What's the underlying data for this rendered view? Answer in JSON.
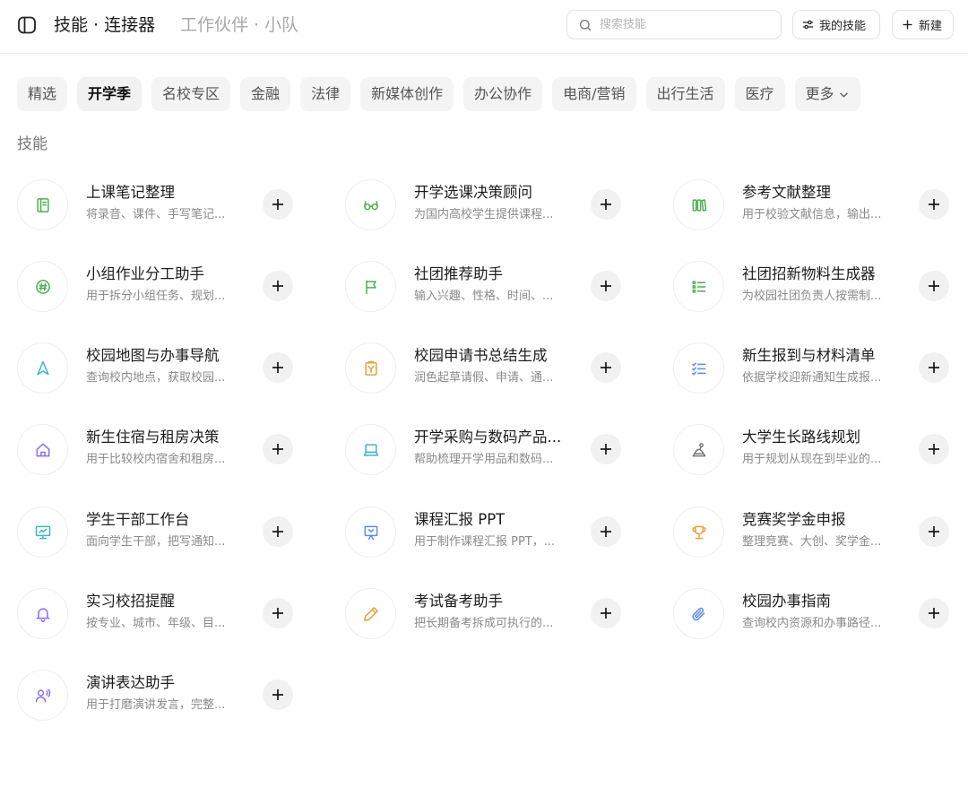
{
  "header": {
    "title_active": "技能 · 连接器",
    "title_inactive": "工作伙伴 · 小队",
    "search_placeholder": "搜索技能",
    "my_skills_label": "我的技能",
    "new_label": "新建"
  },
  "tabs": [
    {
      "label": "精选"
    },
    {
      "label": "开学季",
      "active": true
    },
    {
      "label": "名校专区"
    },
    {
      "label": "金融"
    },
    {
      "label": "法律"
    },
    {
      "label": "新媒体创作"
    },
    {
      "label": "办公协作"
    },
    {
      "label": "电商/营销"
    },
    {
      "label": "出行生活"
    },
    {
      "label": "医疗"
    },
    {
      "label": "更多",
      "dropdown": true
    }
  ],
  "section_label": "技能",
  "skills": [
    {
      "title": "上课笔记整理",
      "desc": "将录音、课件、手写笔记...",
      "icon": "notebook-icon",
      "color": "#4caf50"
    },
    {
      "title": "开学选课决策顾问",
      "desc": "为国内高校学生提供课程...",
      "icon": "glasses-icon",
      "color": "#4caf50"
    },
    {
      "title": "参考文献整理",
      "desc": "用于校验文献信息，输出...",
      "icon": "books-icon",
      "color": "#4caf50"
    },
    {
      "title": "小组作业分工助手",
      "desc": "用于拆分小组任务、规划...",
      "icon": "hashtag-icon",
      "color": "#4caf50"
    },
    {
      "title": "社团推荐助手",
      "desc": "输入兴趣、性格、时间、...",
      "icon": "flag-icon",
      "color": "#4caf50"
    },
    {
      "title": "社团招新物料生成器",
      "desc": "为校园社团负责人按需制...",
      "icon": "list-icon",
      "color": "#4caf50"
    },
    {
      "title": "校园地图与办事导航",
      "desc": "查询校内地点，获取校园...",
      "icon": "navigation-icon",
      "color": "#3fb6c4"
    },
    {
      "title": "校园申请书总结生成",
      "desc": "润色起草请假、申请、通...",
      "icon": "clipboard-icon",
      "color": "#e6a23c"
    },
    {
      "title": "新生报到与材料清单",
      "desc": "依据学校迎新通知生成报...",
      "icon": "checklist-icon",
      "color": "#5b8def"
    },
    {
      "title": "新生住宿与租房决策",
      "desc": "用于比较校内宿舍和租房...",
      "icon": "home-icon",
      "color": "#8b6cf0"
    },
    {
      "title": "开学采购与数码产品...",
      "desc": "帮助梳理开学用品和数码...",
      "icon": "laptop-icon",
      "color": "#3fb6c4"
    },
    {
      "title": "大学生长路线规划",
      "desc": "用于规划从现在到毕业的...",
      "icon": "route-icon",
      "color": "#777777"
    },
    {
      "title": "学生干部工作台",
      "desc": "面向学生干部，把写通知...",
      "icon": "monitor-icon",
      "color": "#3fb6c4"
    },
    {
      "title": "课程汇报 PPT",
      "desc": "用于制作课程汇报 PPT，...",
      "icon": "presentation-icon",
      "color": "#5b8def"
    },
    {
      "title": "竞赛奖学金申报",
      "desc": "整理竞赛、大创、奖学金...",
      "icon": "trophy-icon",
      "color": "#e6a23c"
    },
    {
      "title": "实习校招提醒",
      "desc": "按专业、城市、年级、目...",
      "icon": "bell-icon",
      "color": "#8b6cf0"
    },
    {
      "title": "考试备考助手",
      "desc": "把长期备考拆成可执行的...",
      "icon": "pencil-icon",
      "color": "#e6a23c"
    },
    {
      "title": "校园办事指南",
      "desc": "查询校内资源和办事路径...",
      "icon": "paperclip-icon",
      "color": "#5b8def"
    },
    {
      "title": "演讲表达助手",
      "desc": "用于打磨演讲发言，完整...",
      "icon": "speaker-icon",
      "color": "#8b6cf0"
    }
  ]
}
